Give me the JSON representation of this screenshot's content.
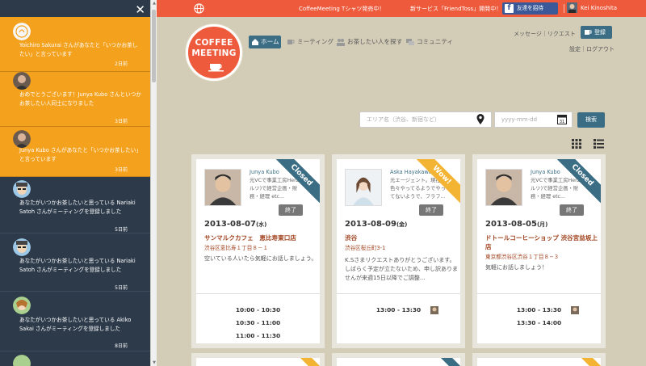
{
  "notifications": {
    "close_label": "✕",
    "items": [
      {
        "text": "Yoichiro Sakurai さんがあなたと「いつかお茶したい」と言っています",
        "time": "2日前",
        "style": "orange"
      },
      {
        "text": "おめでとうございます！Junya Kubo さんといつかお茶したい人同士になりました",
        "time": "3日前",
        "style": "orange"
      },
      {
        "text": "Junya Kubo さんがあなたと「いつかお茶したい」と言っています",
        "time": "3日前",
        "style": "orange"
      },
      {
        "text": "あなたがいつかお茶したいと思っている Nariaki Satoh さんがミーティングを登録しました",
        "time": "5日前",
        "style": "dark"
      },
      {
        "text": "あなたがいつかお茶したいと思っている Nariaki Satoh さんがミーティングを登録しました",
        "time": "5日前",
        "style": "dark"
      },
      {
        "text": "あなたがいつかお茶したいと思っている Akiko Sakai さんがミーティングを登録しました",
        "time": "8日前",
        "style": "dark"
      }
    ]
  },
  "topbar": {
    "news1": "CoffeeMeeting Tシャツ発売中！",
    "news2": "新サービス「FriendToss」開発中！",
    "fb_invite": "友達を招待",
    "username": "Kei Kinoshita"
  },
  "logo": {
    "line1": "COFFEE",
    "line2": "MEETING"
  },
  "nav": {
    "home": "ホーム",
    "meeting": "ミーティング",
    "find": "お茶したい人を探す",
    "community": "コミュニティ"
  },
  "header_links": {
    "message_request": "メッセージ｜リクエスト",
    "register": "登録",
    "settings_logout": "設定｜ログアウト"
  },
  "search": {
    "area_placeholder": "エリア名（渋谷、新宿など）",
    "date_placeholder": "yyyy-mm-dd",
    "button": "検索"
  },
  "cards": [
    {
      "user": "Junya Kubo",
      "desc": "元VCで事業工房Herz(ヘルツ)で経営企画・財務・経理 etc...",
      "ribbon": "Closed",
      "ribbon_style": "closed",
      "end_label": "終了",
      "date": "2013-08-07",
      "dow": "(水)",
      "place": "サンマルクカフェ　恵比寿東口店",
      "addr": "渋谷区恵比寿１丁目８－１",
      "message": "空いている人いたら気軽にお話しましょう。",
      "slots": [
        "10:00 - 10:30",
        "10:30 - 11:00",
        "11:00 - 11:30"
      ],
      "slot_avatar_index": -1
    },
    {
      "user": "Aska Hayakawa",
      "desc": "元エージェント。現在は色々やってるようでやってないようで、フラフ...",
      "ribbon": "Wow!",
      "ribbon_style": "wow",
      "end_label": "終了",
      "date": "2013-08-09",
      "dow": "(金)",
      "place": "渋谷",
      "addr": "渋谷区桜丘町3-1",
      "message": "K.Sさまリクエストありがとうございます。 しばらく予定が立たないため、申し訳ありませんが来週15日以降でご調整...",
      "slots": [
        "13:00 - 13:30"
      ],
      "slot_avatar_index": 0
    },
    {
      "user": "Junya Kubo",
      "desc": "元VCで事業工房Herz(ヘルツ)で経営企画・財務・経理 etc...",
      "ribbon": "Closed",
      "ribbon_style": "closed",
      "end_label": "終了",
      "date": "2013-08-05",
      "dow": "(月)",
      "place": "ドトールコーヒーショップ 渋谷宮益坂上店",
      "addr": "東京都渋谷区渋谷１丁目８−３",
      "message": "気軽にお話しましょう！",
      "slots": [
        "13:00 - 13:30",
        "13:30 - 14:00"
      ],
      "slot_avatar_index": 0
    }
  ]
}
